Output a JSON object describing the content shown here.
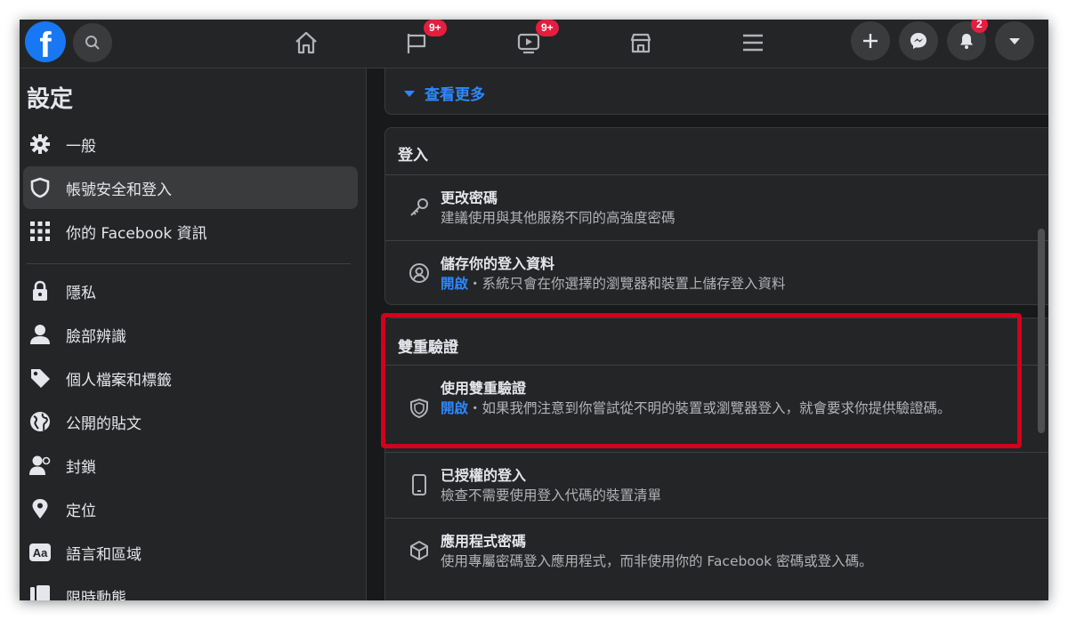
{
  "topbar": {
    "logo": "f",
    "badges": {
      "pages": "9+",
      "watch": "9+",
      "notifications": "2"
    }
  },
  "sidebar": {
    "title": "設定",
    "items": [
      {
        "label": "一般",
        "icon": "gear-icon"
      },
      {
        "label": "帳號安全和登入",
        "icon": "shield-icon",
        "active": true
      },
      {
        "label": "你的 Facebook 資訊",
        "icon": "grid-icon"
      },
      {
        "label": "隱私",
        "icon": "lock-icon"
      },
      {
        "label": "臉部辨識",
        "icon": "face-icon"
      },
      {
        "label": "個人檔案和標籤",
        "icon": "tag-icon"
      },
      {
        "label": "公開的貼文",
        "icon": "globe-icon"
      },
      {
        "label": "封鎖",
        "icon": "block-user-icon"
      },
      {
        "label": "定位",
        "icon": "location-pin-icon"
      },
      {
        "label": "語言和區域",
        "icon": "language-icon"
      },
      {
        "label": "限時動態",
        "icon": "stories-icon"
      }
    ]
  },
  "main": {
    "see_more": "查看更多",
    "login": {
      "heading": "登入",
      "rows": [
        {
          "title": "更改密碼",
          "desc": "建議使用與其他服務不同的高強度密碼"
        },
        {
          "title": "儲存你的登入資料",
          "status": "開啟",
          "desc": "・系統只會在你選擇的瀏覽器和裝置上儲存登入資料"
        }
      ]
    },
    "two_factor": {
      "heading": "雙重驗證",
      "rows": [
        {
          "title": "使用雙重驗證",
          "status": "開啟",
          "desc": "・如果我們注意到你嘗試從不明的裝置或瀏覽器登入，就會要求你提供驗證碼。"
        },
        {
          "title": "已授權的登入",
          "desc": "檢查不需要使用登入代碼的裝置清單"
        },
        {
          "title": "應用程式密碼",
          "desc": "使用專屬密碼登入應用程式，而非使用你的 Facebook 密碼或登入碼。"
        }
      ]
    }
  },
  "colors": {
    "accent": "#2d88ff",
    "highlight_border": "#d0021b",
    "badge": "#e41e3f"
  }
}
